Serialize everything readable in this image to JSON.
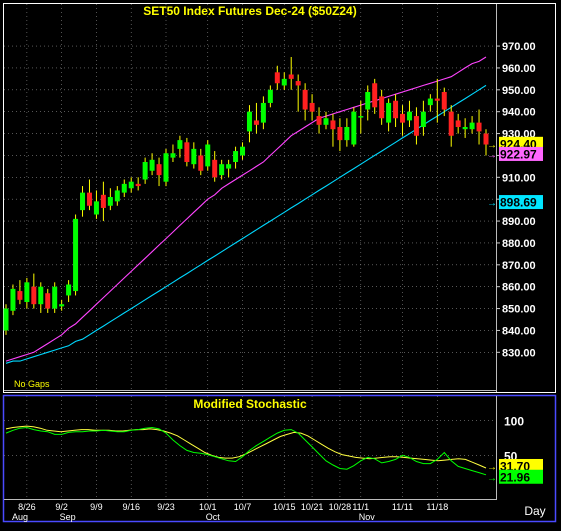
{
  "chart_data": [
    {
      "type": "candlestick",
      "title": "SET50  Index  Futures  Dec-24  ($50Z24)",
      "annotation": "No Gaps",
      "y_ticks": [
        830,
        840,
        850,
        860,
        870,
        880,
        890,
        900,
        910,
        920,
        930,
        940,
        950,
        960,
        970
      ],
      "ylim": [
        821,
        981
      ],
      "x_tick_labels": [
        "8/26",
        "9/2",
        "9/9",
        "9/16",
        "9/23",
        "10/1",
        "10/7",
        "10/15",
        "10/21",
        "10/28",
        "11/1",
        "11/11",
        "11/18"
      ],
      "x_tick_index": [
        3,
        8,
        13,
        18,
        23,
        29,
        34,
        40,
        44,
        48,
        51,
        57,
        62
      ],
      "month_labels": [
        "Aug",
        "Sep",
        "Oct",
        "Nov"
      ],
      "month_index": [
        0,
        8,
        29,
        51
      ],
      "x_axis_title": "Day",
      "last_values": [
        {
          "label": "924.40",
          "value": 924.4,
          "color": "#ffff00"
        },
        {
          "label": "922.97",
          "value": 922.97,
          "color": "#ff66ff"
        },
        {
          "label": "898.69",
          "value": 898.69,
          "color": "#00e5ff"
        }
      ],
      "candles": [
        [
          840,
          850,
          838,
          852
        ],
        [
          849,
          859,
          847,
          861
        ],
        [
          858,
          854,
          852,
          863
        ],
        [
          853,
          862,
          850,
          864
        ],
        [
          860,
          852,
          850,
          866
        ],
        [
          852,
          860,
          848,
          862
        ],
        [
          857,
          850,
          848,
          859
        ],
        [
          850,
          860,
          848,
          862
        ],
        [
          851,
          852,
          849,
          854
        ],
        [
          856,
          861,
          853,
          863
        ],
        [
          858,
          891,
          856,
          893
        ],
        [
          895,
          903,
          892,
          906
        ],
        [
          903,
          897,
          895,
          909
        ],
        [
          893,
          899,
          891,
          904
        ],
        [
          902,
          896,
          890,
          908
        ],
        [
          897,
          901,
          895,
          905
        ],
        [
          899,
          904,
          897,
          906
        ],
        [
          903,
          907,
          901,
          909
        ],
        [
          905,
          908,
          903,
          910
        ],
        [
          907,
          906,
          904,
          910
        ],
        [
          909,
          917,
          907,
          919
        ],
        [
          913,
          918,
          911,
          921
        ],
        [
          916,
          911,
          906,
          919
        ],
        [
          908,
          921,
          906,
          923
        ],
        [
          919,
          921,
          917,
          925
        ],
        [
          923,
          927,
          919,
          929
        ],
        [
          926,
          917,
          915,
          928
        ],
        [
          916,
          923,
          914,
          926
        ],
        [
          920,
          913,
          911,
          923
        ],
        [
          915,
          925,
          913,
          927
        ],
        [
          918,
          910,
          908,
          922
        ],
        [
          911,
          916,
          909,
          918
        ],
        [
          914,
          916,
          910,
          918
        ],
        [
          917,
          922,
          914,
          924
        ],
        [
          920,
          924,
          918,
          926
        ],
        [
          931,
          940,
          926,
          943
        ],
        [
          936,
          934,
          930,
          944
        ],
        [
          935,
          944,
          932,
          947
        ],
        [
          944,
          950,
          942,
          952
        ],
        [
          958,
          953,
          950,
          961
        ],
        [
          952,
          955,
          950,
          958
        ],
        [
          957,
          955,
          950,
          965
        ],
        [
          954,
          952,
          940,
          957
        ],
        [
          950,
          941,
          936,
          953
        ],
        [
          944,
          940,
          936,
          948
        ],
        [
          938,
          934,
          930,
          942
        ],
        [
          934,
          937,
          932,
          940
        ],
        [
          936,
          932,
          924,
          939
        ],
        [
          933,
          927,
          922,
          937
        ],
        [
          927,
          933,
          924,
          937
        ],
        [
          925,
          940,
          924,
          942
        ],
        [
          938,
          938,
          930,
          945
        ],
        [
          941,
          949,
          936,
          952
        ],
        [
          953,
          942,
          939,
          955
        ],
        [
          947,
          937,
          934,
          950
        ],
        [
          935,
          944,
          931,
          946
        ],
        [
          945,
          937,
          933,
          948
        ],
        [
          939,
          935,
          929,
          943
        ],
        [
          936,
          940,
          933,
          945
        ],
        [
          938,
          929,
          925,
          942
        ],
        [
          933,
          940,
          929,
          945
        ],
        [
          943,
          946,
          940,
          948
        ],
        [
          946,
          945,
          935,
          955
        ],
        [
          949,
          941,
          938,
          951
        ],
        [
          940,
          929,
          924,
          943
        ],
        [
          936,
          933,
          930,
          939
        ],
        [
          932,
          933,
          928,
          937
        ],
        [
          932,
          935,
          930,
          938
        ],
        [
          935,
          931,
          925,
          941
        ],
        [
          930,
          925,
          920,
          932
        ]
      ],
      "series": [
        {
          "name": "",
          "color": "#ff44ff",
          "values": [
            826,
            827,
            828,
            829,
            830,
            832,
            834,
            836,
            838,
            841,
            843,
            846,
            849,
            852,
            855,
            858,
            861,
            864,
            867,
            870,
            873,
            876,
            879,
            882,
            885,
            888,
            891,
            894,
            897,
            900,
            902,
            905,
            907,
            909,
            911,
            913,
            915,
            917,
            920,
            923,
            926,
            929,
            931,
            933,
            935,
            937,
            938,
            939,
            940,
            941,
            942,
            943,
            944,
            945,
            946,
            947,
            948,
            949,
            950,
            951,
            952,
            953,
            954,
            955,
            956,
            958,
            960,
            962,
            963,
            965
          ]
        },
        {
          "name": "",
          "color": "#00d8ff",
          "values": [
            825,
            826,
            826,
            827,
            828,
            829,
            830,
            831,
            832,
            833,
            835,
            836,
            838,
            840,
            842,
            844,
            846,
            848,
            850,
            852,
            854,
            856,
            858,
            860,
            862,
            864,
            866,
            868,
            870,
            872,
            874,
            876,
            878,
            880,
            882,
            884,
            886,
            888,
            890,
            892,
            894,
            896,
            898,
            900,
            902,
            904,
            906,
            908,
            910,
            912,
            914,
            916,
            918,
            920,
            922,
            924,
            926,
            928,
            930,
            932,
            934,
            936,
            938,
            940,
            942,
            944,
            946,
            948,
            950,
            952
          ]
        }
      ]
    },
    {
      "type": "line",
      "title": "Modified  Stochastic",
      "y_ticks": [
        100,
        50
      ],
      "ylim": [
        0,
        108
      ],
      "last_values": [
        {
          "label": "31.70",
          "value": 31.7,
          "color": "#ffff00"
        },
        {
          "label": "21.96",
          "value": 21.96,
          "color": "#00ff00"
        }
      ],
      "series": [
        {
          "name": "",
          "color": "#ffff40",
          "values": [
            88,
            90,
            91,
            92,
            91,
            89,
            86,
            85,
            84,
            85,
            86,
            87,
            87,
            86,
            86,
            86,
            85,
            85,
            86,
            87,
            87,
            88,
            87,
            85,
            82,
            78,
            72,
            66,
            60,
            54,
            50,
            47,
            46,
            46,
            48,
            52,
            57,
            62,
            67,
            72,
            77,
            80,
            83,
            82,
            78,
            72,
            66,
            60,
            55,
            51,
            49,
            47,
            46,
            45,
            46,
            47,
            48,
            48,
            47,
            46,
            45,
            44,
            43,
            42,
            43,
            44,
            45,
            44,
            40,
            36,
            31.7
          ]
        },
        {
          "name": "",
          "color": "#00ff00",
          "values": [
            82,
            86,
            89,
            90,
            87,
            85,
            84,
            80,
            80,
            83,
            84,
            84,
            85,
            85,
            86,
            85,
            84,
            84,
            86,
            87,
            89,
            90,
            88,
            82,
            72,
            64,
            57,
            54,
            53,
            51,
            48,
            45,
            42,
            41,
            48,
            57,
            64,
            70,
            76,
            82,
            86,
            87,
            82,
            72,
            62,
            52,
            42,
            36,
            31,
            30,
            35,
            42,
            47,
            45,
            39,
            41,
            44,
            50,
            47,
            41,
            38,
            38,
            44,
            54,
            42,
            34,
            31,
            28,
            25,
            21.96
          ]
        }
      ]
    }
  ]
}
